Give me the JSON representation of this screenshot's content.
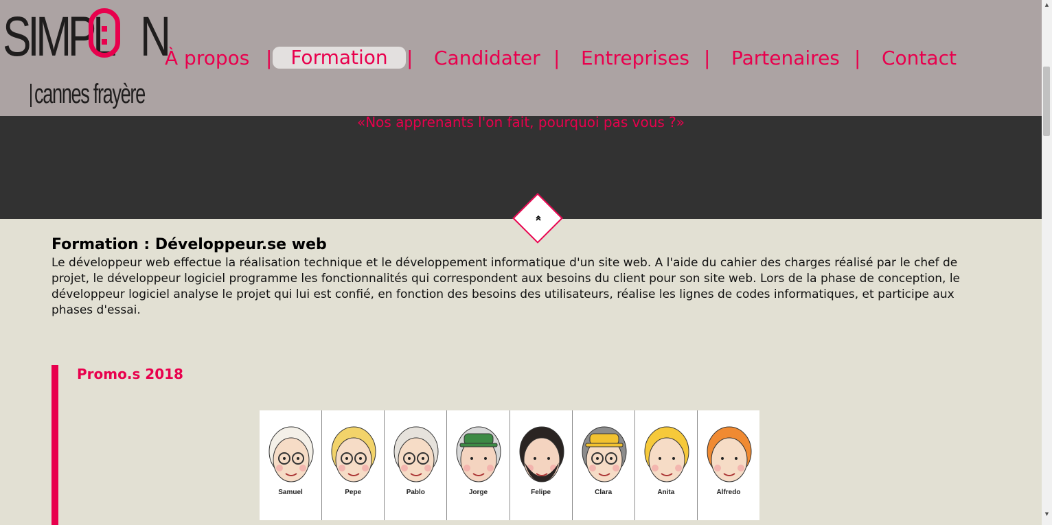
{
  "logo": {
    "main": "SIMPL",
    "main_tail": "N",
    "subtitle": "cannes frayère",
    "accent": "#e8004d"
  },
  "nav": {
    "items": [
      {
        "label": "À propos"
      },
      {
        "label": "Formation"
      },
      {
        "label": "Candidater"
      },
      {
        "label": "Entreprises"
      },
      {
        "label": "Partenaires"
      },
      {
        "label": "Contact"
      }
    ],
    "separator": "|",
    "active": "Formation"
  },
  "hero": {
    "tagline": "«Nos apprenants l'on fait, pourquoi pas vous ?»",
    "scroll_up_icon": "double-chevron-up-icon"
  },
  "section": {
    "title": "Formation : Développeur.se web",
    "body": "Le développeur web effectue la réalisation technique et le développement informatique d'un site web. A l'aide du cahier des charges réalisé par le chef de projet, le développeur logiciel programme les fonctionnalités qui correspondent aux besoins du client pour son site web. Lors de la phase de conception, le développeur logiciel analyse le projet qui lui est confié, en fonction des besoins des utilisateurs, réalise les lignes de codes informatiques, et participe aux phases d'essai."
  },
  "promo": {
    "title": "Promo.s 2018",
    "people": [
      {
        "name": "Samuel",
        "hair": "#f4f0e8",
        "skin": "#f6dcc6",
        "glasses": true,
        "hat": null,
        "beard": false
      },
      {
        "name": "Pepe",
        "hair": "#f2d36a",
        "skin": "#f6dcc6",
        "glasses": true,
        "hat": null,
        "beard": false
      },
      {
        "name": "Pablo",
        "hair": "#e6e2dc",
        "skin": "#f6dcc6",
        "glasses": true,
        "hat": null,
        "beard": false
      },
      {
        "name": "Jorge",
        "hair": "#d8d8d8",
        "skin": "#f4d4c0",
        "glasses": false,
        "hat": "#3d8a45",
        "beard": false
      },
      {
        "name": "Felipe",
        "hair": "#2a2422",
        "skin": "#f4d4c0",
        "glasses": false,
        "hat": null,
        "beard": true
      },
      {
        "name": "Clara",
        "hair": "#8c8c8c",
        "skin": "#f6dcc6",
        "glasses": true,
        "hat": "#f2c230",
        "beard": false
      },
      {
        "name": "Anita",
        "hair": "#f6c93a",
        "skin": "#f6dcc6",
        "glasses": false,
        "hat": null,
        "beard": false
      },
      {
        "name": "Alfredo",
        "hair": "#f08a32",
        "skin": "#f6dcc6",
        "glasses": false,
        "hat": null,
        "beard": false
      }
    ]
  },
  "scrollbar": {
    "up_icon": "scroll-up-arrow-icon",
    "down_icon": "scroll-down-arrow-icon"
  }
}
